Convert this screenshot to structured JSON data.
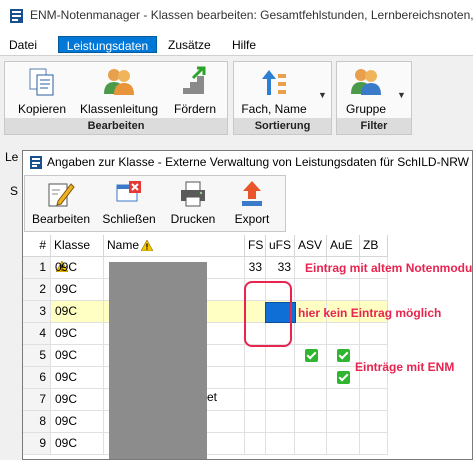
{
  "window": {
    "title": "ENM-Notenmanager - Klassen bearbeiten: Gesamtfehlstunden, Lernbereichsnoten, B"
  },
  "menu": {
    "items": [
      "Datei",
      "Leistungsdaten",
      "Zusätze",
      "Hilfe"
    ],
    "active": "Leistungsdaten"
  },
  "ribbon": {
    "groups": [
      {
        "label": "Bearbeiten",
        "buttons": [
          "Kopieren",
          "Klassenleitung",
          "Fördern"
        ]
      },
      {
        "label": "Sortierung",
        "buttons": [
          "Fach, Name"
        ]
      },
      {
        "label": "Filter",
        "buttons": [
          "Gruppe"
        ]
      }
    ]
  },
  "behind": {
    "label1": "Le",
    "label2": "S"
  },
  "dialog": {
    "title": "Angaben zur Klasse - Externe Verwaltung von Leistungsdaten für SchILD-NRW",
    "toolbar": [
      "Bearbeiten",
      "Schließen",
      "Drucken",
      "Export"
    ]
  },
  "grid": {
    "columns": [
      "#",
      "Klasse",
      "Name",
      "FS",
      "uFS",
      "ASV",
      "AuE",
      "ZB"
    ],
    "rows": [
      {
        "n": "1",
        "klasse": "09C",
        "fs": "33",
        "ufs": "33",
        "asv": false,
        "aue": false
      },
      {
        "n": "2",
        "klasse": "09C",
        "fs": "",
        "ufs": "",
        "asv": false,
        "aue": false
      },
      {
        "n": "3",
        "klasse": "09C",
        "fs": "",
        "ufs": "",
        "asv": false,
        "aue": false
      },
      {
        "n": "4",
        "klasse": "09C",
        "fs": "",
        "ufs": "",
        "asv": false,
        "aue": false
      },
      {
        "n": "5",
        "klasse": "09C",
        "fs": "",
        "ufs": "",
        "asv": true,
        "aue": true
      },
      {
        "n": "6",
        "klasse": "09C",
        "fs": "",
        "ufs": "",
        "asv": false,
        "aue": true
      },
      {
        "n": "7",
        "klasse": "09C",
        "fs": "",
        "ufs": "",
        "asv": false,
        "aue": false
      },
      {
        "n": "8",
        "klasse": "09C",
        "fs": "",
        "ufs": "",
        "asv": false,
        "aue": false
      },
      {
        "n": "9",
        "klasse": "09C",
        "fs": "",
        "ufs": "",
        "asv": false,
        "aue": false
      }
    ],
    "name_fragment": "et"
  },
  "annotations": {
    "a1": "Eintrag mit altem Notenmodul",
    "a2": "hier kein Eintrag möglich",
    "a3": "Einträge mit ENM"
  },
  "colors": {
    "accent": "#0078d7",
    "annotation": "#e8244f",
    "highlight_row": "#ffffc4",
    "check": "#2fb52f"
  }
}
